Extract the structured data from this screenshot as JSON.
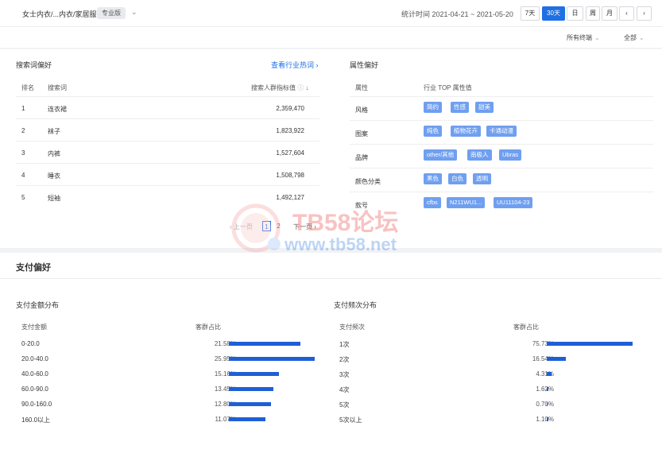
{
  "header": {
    "breadcrumb": "女士内衣/...内衣/家居服",
    "badge": "专业版",
    "stat_time": "统计时间 2021-04-21 ~ 2021-05-20",
    "ranges": [
      "7天",
      "30天",
      "日",
      "周",
      "月"
    ],
    "active_range": "30天",
    "prev_icon": "chevron-left-icon",
    "next_icon": "chevron-right-icon"
  },
  "filters": {
    "terminal": "所有终端",
    "scope": "全部"
  },
  "search_pref": {
    "title": "搜索词偏好",
    "link": "查看行业热词",
    "columns": {
      "rank": "排名",
      "keyword": "搜索词",
      "index": "搜索人群指标值"
    },
    "rows": [
      {
        "rank": "1",
        "keyword": "连衣裙",
        "value": "2,359,470"
      },
      {
        "rank": "2",
        "keyword": "袜子",
        "value": "1,823,922"
      },
      {
        "rank": "3",
        "keyword": "内裤",
        "value": "1,527,604"
      },
      {
        "rank": "4",
        "keyword": "睡衣",
        "value": "1,508,798"
      },
      {
        "rank": "5",
        "keyword": "短袖",
        "value": "1,492,127"
      }
    ],
    "pager": {
      "prev": "上一页",
      "pages": [
        "1",
        "2"
      ],
      "next": "下一页"
    }
  },
  "attr_pref": {
    "title": "属性偏好",
    "columns": {
      "attr": "属性",
      "top": "行业 TOP 属性值"
    },
    "rows": [
      {
        "label": "风格",
        "tags": [
          "简约",
          "性感",
          "甜美"
        ]
      },
      {
        "label": "图案",
        "tags": [
          "纯色",
          "植物花卉",
          "卡通动漫"
        ]
      },
      {
        "label": "品牌",
        "tags": [
          "other/其他",
          "南极人",
          "Ubras"
        ]
      },
      {
        "label": "颜色分类",
        "tags": [
          "黑色",
          "白色",
          "透明"
        ]
      },
      {
        "label": "款号",
        "tags": [
          "cfbs",
          "N211WU1...",
          "UU11104-23"
        ]
      }
    ]
  },
  "payment": {
    "title": "支付偏好",
    "amount": {
      "title": "支付金额分布",
      "col_label": "支付金额",
      "col_pct": "客群占比",
      "rows": [
        {
          "label": "0-20.0",
          "pct": "21.58%",
          "value": 21.58
        },
        {
          "label": "20.0-40.0",
          "pct": "25.95%",
          "value": 25.95
        },
        {
          "label": "40.0-60.0",
          "pct": "15.16%",
          "value": 15.16
        },
        {
          "label": "60.0-90.0",
          "pct": "13.45%",
          "value": 13.45
        },
        {
          "label": "90.0-160.0",
          "pct": "12.80%",
          "value": 12.8
        },
        {
          "label": "160.0以上",
          "pct": "11.07%",
          "value": 11.07
        }
      ]
    },
    "freq": {
      "title": "支付频次分布",
      "col_label": "支付频次",
      "col_pct": "客群占比",
      "rows": [
        {
          "label": "1次",
          "pct": "75.73%",
          "value": 75.73
        },
        {
          "label": "2次",
          "pct": "16.54%",
          "value": 16.54
        },
        {
          "label": "3次",
          "pct": "4.31%",
          "value": 4.31
        },
        {
          "label": "4次",
          "pct": "1.62%",
          "value": 1.62
        },
        {
          "label": "5次",
          "pct": "0.70%",
          "value": 0.7
        },
        {
          "label": "5次以上",
          "pct": "1.10%",
          "value": 1.1
        }
      ]
    }
  },
  "watermark": {
    "brand": "TB58论坛",
    "url": "www.tb58.net"
  },
  "colors": {
    "accent": "#1f6fe5",
    "bar": "#1f5fd6",
    "tag": "#6f9ff0"
  }
}
